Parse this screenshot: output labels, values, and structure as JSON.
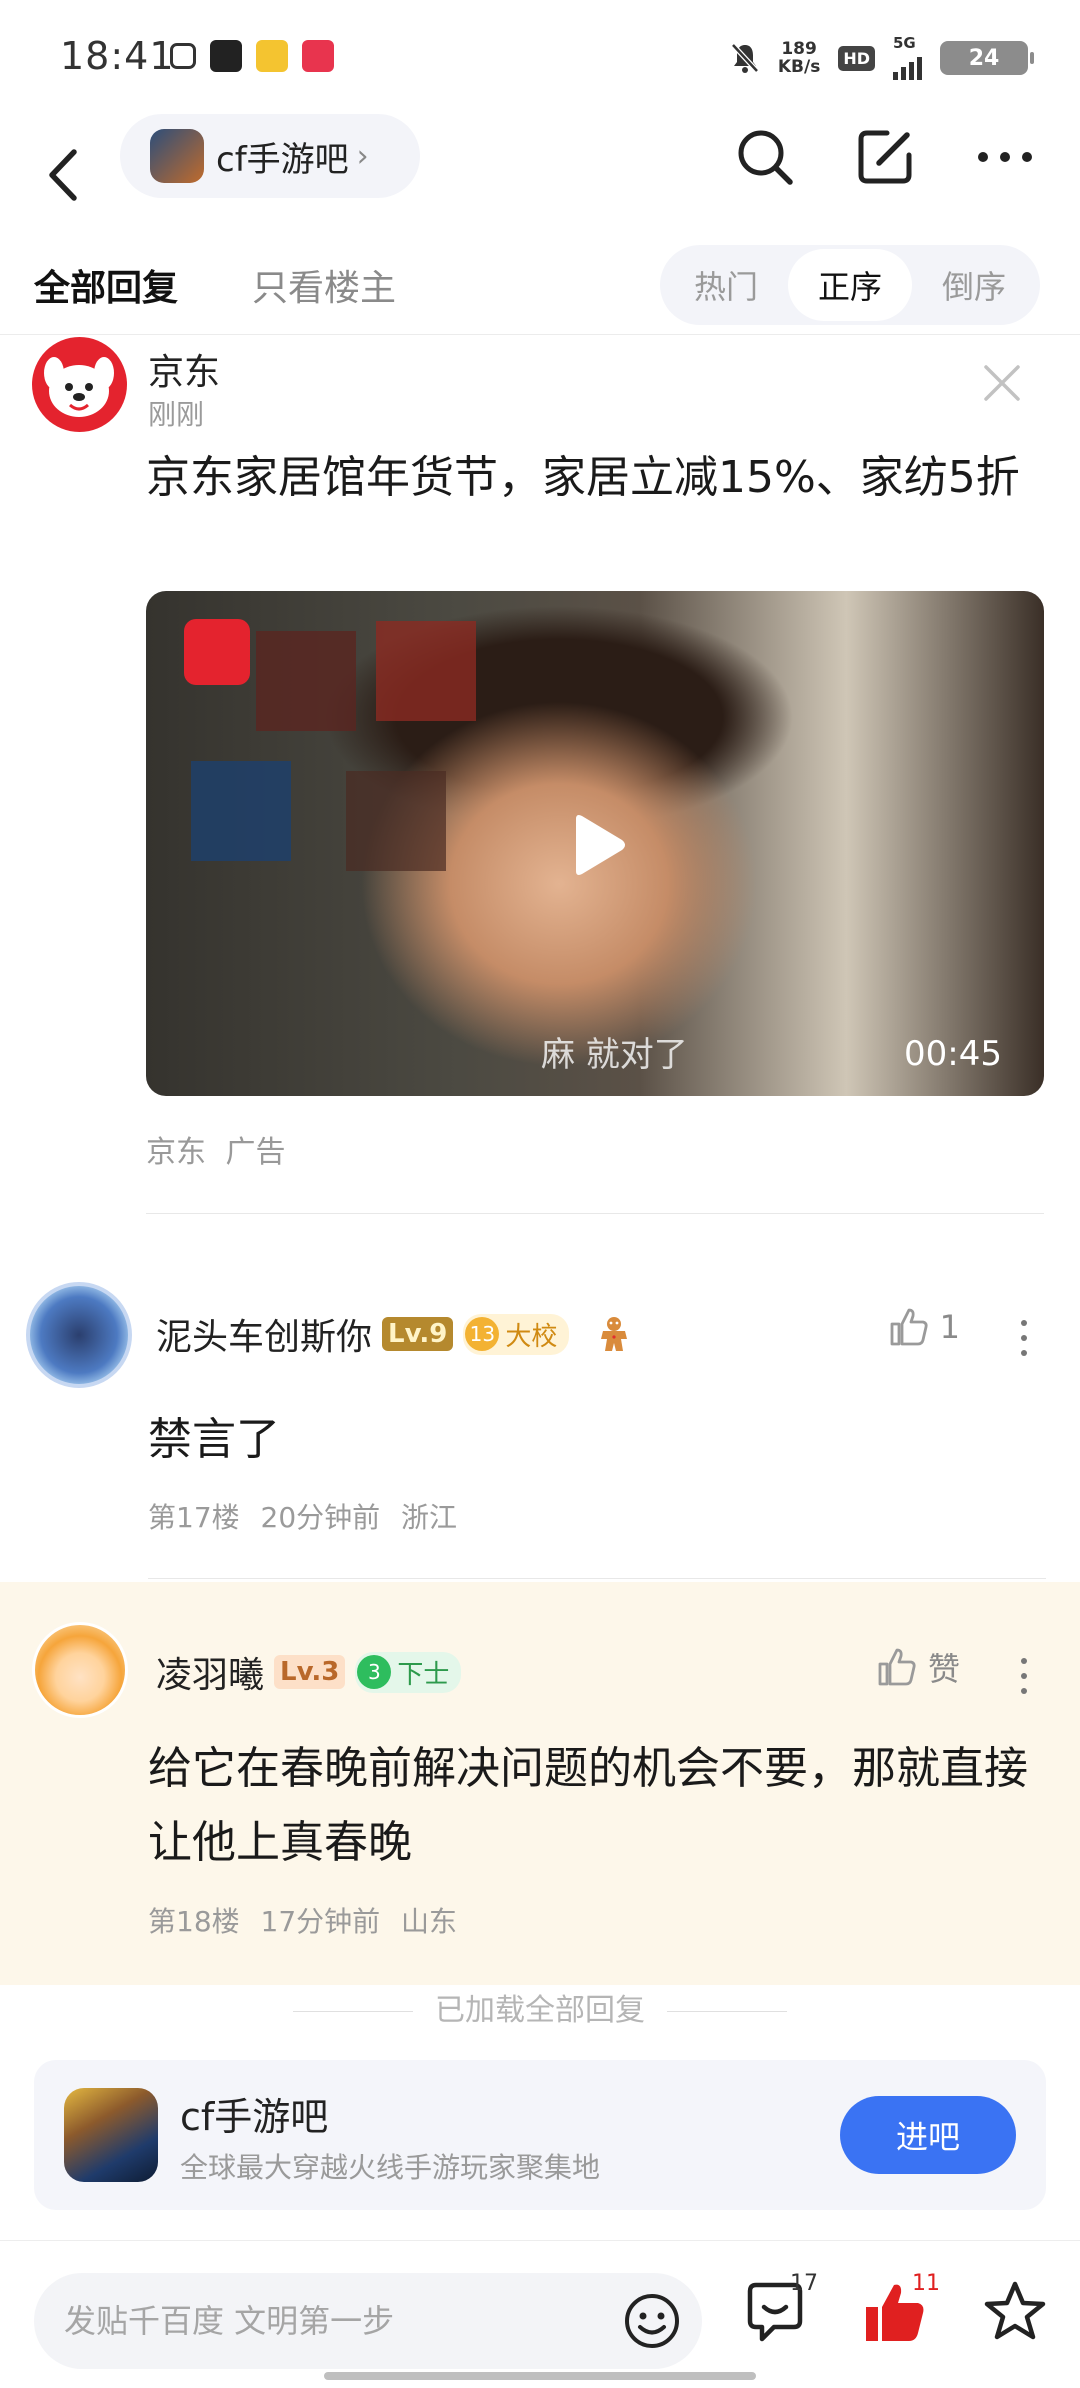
{
  "status_bar": {
    "time": "18:41",
    "net_speed_value": "189",
    "net_speed_unit": "KB/s",
    "hd": "HD",
    "network": "5G",
    "battery": "24"
  },
  "nav": {
    "forum_name": "cf手游吧",
    "icons": [
      "back-icon",
      "search-icon",
      "compose-icon",
      "more-icon"
    ]
  },
  "tabs": {
    "all_replies": "全部回复",
    "op_only": "只看楼主",
    "sort": [
      "热门",
      "正序",
      "倒序"
    ],
    "selected_sort": "正序"
  },
  "ad": {
    "author": "京东",
    "time": "刚刚",
    "title": "京东家居馆年货节，家居立减15%、家纺5折",
    "video_duration": "00:45",
    "video_caption": "麻 就对了",
    "meta": "京东  广告"
  },
  "replies": [
    {
      "user": "泥头车创斯你",
      "level": "Lv.9",
      "rank_num": "13",
      "rank_title": "大校",
      "likes": "1",
      "content": "禁言了",
      "meta": "第17楼  20分钟前  浙江"
    },
    {
      "user": "凌羽曦",
      "level": "Lv.3",
      "rank_num": "3",
      "rank_title": "下士",
      "likes": "赞",
      "content": "给它在春晚前解决问题的机会不要，那就直接让他上真春晚",
      "meta": "第18楼  17分钟前  山东"
    }
  ],
  "loaded_text": "已加载全部回复",
  "forum_card": {
    "name": "cf手游吧",
    "desc": "全球最大穿越火线手游玩家聚集地",
    "button": "进吧"
  },
  "bottom_bar": {
    "placeholder": "发贴千百度 文明第一步",
    "comment_count": "17",
    "like_count": "11"
  },
  "colors": {
    "accent_blue": "#3a73f3",
    "like_red": "#e02020",
    "highlight_bg": "#fdf7ea"
  }
}
